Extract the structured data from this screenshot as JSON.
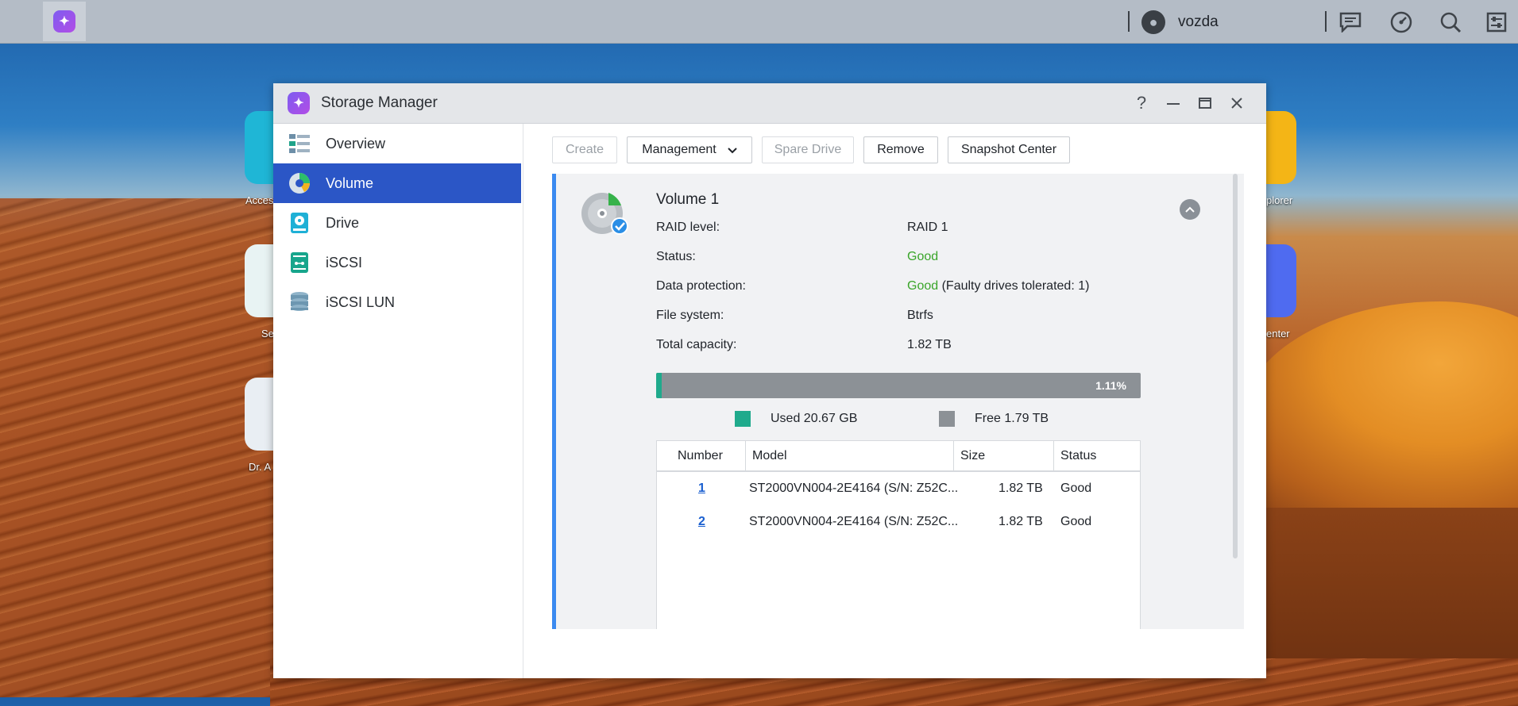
{
  "taskbar": {
    "username": "vozda",
    "icons": [
      "app-launcher-icon",
      "user-icon",
      "messages-icon",
      "dashboard-icon",
      "search-icon",
      "settings-icon"
    ]
  },
  "desktop": {
    "labels": [
      "Acces",
      "Se",
      "Dr. A",
      "plorer",
      "enter"
    ]
  },
  "window": {
    "title": "Storage Manager",
    "controls": [
      "help-icon",
      "minimize-icon",
      "maximize-icon",
      "close-icon"
    ]
  },
  "sidebar": {
    "items": [
      {
        "label": "Overview",
        "icon": "overview-icon"
      },
      {
        "label": "Volume",
        "icon": "volume-icon",
        "active": true
      },
      {
        "label": "Drive",
        "icon": "drive-icon"
      },
      {
        "label": "iSCSI",
        "icon": "iscsi-icon"
      },
      {
        "label": "iSCSI LUN",
        "icon": "iscsi-lun-icon"
      }
    ]
  },
  "toolbar": {
    "create": "Create",
    "management": "Management",
    "spare_drive": "Spare Drive",
    "remove": "Remove",
    "snapshot_center": "Snapshot Center"
  },
  "volume": {
    "name": "Volume 1",
    "rows": [
      {
        "label": "RAID level:",
        "value": "RAID 1"
      },
      {
        "label": "Status:",
        "value": "Good",
        "status": true
      },
      {
        "label": "Data protection:",
        "value": "Good",
        "extra": " (Faulty drives tolerated: 1)",
        "status": true
      },
      {
        "label": "File system:",
        "value": "Btrfs"
      },
      {
        "label": "Total capacity:",
        "value": "1.82 TB"
      }
    ],
    "usage_percent": "1.11%",
    "usage_fraction": 0.0111,
    "used_label": "Used 20.67 GB",
    "free_label": "Free 1.79 TB"
  },
  "drives": {
    "headers": [
      "Number",
      "Model",
      "Size",
      "Status"
    ],
    "rows": [
      {
        "number": "1",
        "model": "ST2000VN004-2E4164 (S/N: Z52C...",
        "size": "1.82 TB",
        "status": "Good"
      },
      {
        "number": "2",
        "model": "ST2000VN004-2E4164 (S/N: Z52C...",
        "size": "1.82 TB",
        "status": "Good"
      }
    ]
  },
  "colors": {
    "accent": "#2b56c6",
    "good": "#3aa52a",
    "used": "#1faa8c",
    "free": "#8c9196",
    "panel_border": "#3b8af0"
  }
}
